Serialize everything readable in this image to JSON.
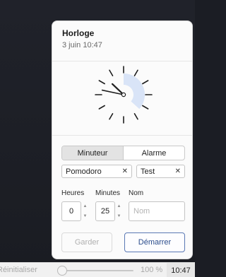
{
  "clock": {
    "title": "Horloge",
    "datetime": "3 juin   10:47",
    "hour_hand_deg": 313.5,
    "minute_hand_deg": 282
  },
  "modes": {
    "timer_label": "Minuteur",
    "alarm_label": "Alarme",
    "active": "timer"
  },
  "presets": [
    {
      "label": "Pomodoro",
      "remove_icon": "close-icon"
    },
    {
      "label": "Test",
      "remove_icon": "close-icon"
    }
  ],
  "form": {
    "hours_label": "Heures",
    "minutes_label": "Minutes",
    "name_label": "Nom",
    "hours_value": "0",
    "minutes_value": "25",
    "name_placeholder": "Nom",
    "name_value": ""
  },
  "actions": {
    "keep_label": "Garder",
    "start_label": "Démarrer"
  },
  "taskbar": {
    "reset_label": "Réinitialiser",
    "zoom_value": "100 %",
    "zoom_fraction": 0.0,
    "time": "10:47"
  },
  "colors": {
    "accent": "#5a78b4",
    "accent_text": "#2b4c8c",
    "dial_arc": "#d9e4f7",
    "background_dark": "#1b1d24"
  }
}
